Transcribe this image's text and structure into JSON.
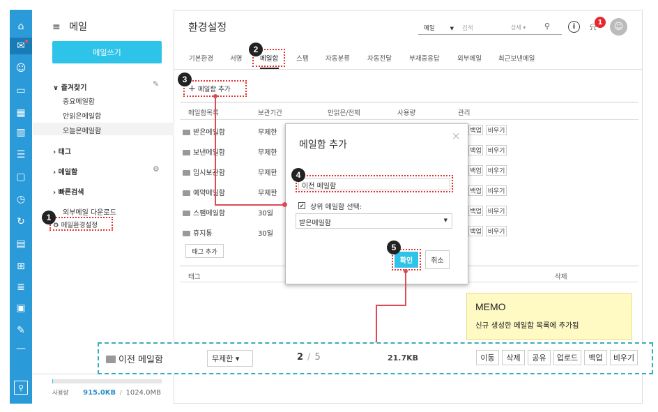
{
  "sidebar_title": "메일",
  "compose_label": "메일쓰기",
  "favorites": {
    "label": "즐겨찾기",
    "items": [
      "중요메일함",
      "안읽은메일함",
      "오늘온메일함"
    ]
  },
  "tags_label": "태그",
  "mailbox_label": "메일함",
  "quick_search_label": "빠른검색",
  "external_download": "외부메일 다운로드",
  "mail_settings": "메일환경설정",
  "usage": {
    "label": "사용량",
    "used": "915.0KB",
    "sep": "/",
    "total": "1024.0MB",
    "fraction": 0.001
  },
  "page_title": "환경설정",
  "search": {
    "scope": "메일",
    "placeholder": "검색",
    "detail": "상세 ▾"
  },
  "notification_count": "1",
  "tabs": [
    "기본환경",
    "서명",
    "메일함",
    "스팸",
    "자동분류",
    "자동전달",
    "부재중응답",
    "외부메일",
    "최근보낸메일"
  ],
  "add_mailbox": "메일함 추가",
  "table_headers": [
    "메일함목록",
    "보관기간",
    "안읽은/전체",
    "사용량",
    "관리"
  ],
  "rows": [
    {
      "name": "받은메일함",
      "period": "무제한"
    },
    {
      "name": "보낸메일함",
      "period": "무제한"
    },
    {
      "name": "임시보관함",
      "period": "무제한"
    },
    {
      "name": "예약메일함",
      "period": "무제한"
    },
    {
      "name": "스팸메일함",
      "period": "30일"
    },
    {
      "name": "휴지통",
      "period": "30일"
    }
  ],
  "row_btns": [
    "백업",
    "비우기"
  ],
  "add_tag": "태그 추가",
  "tag_header": "태그",
  "delete_header": "삭제",
  "dialog": {
    "title": "메일함 추가",
    "close": "×",
    "input_value": "이전 메일함",
    "checkbox_label": "상위 메일함 선택:",
    "select_value": "받은메일함",
    "confirm": "확인",
    "cancel": "취소"
  },
  "memo": {
    "title": "MEMO",
    "text": "신규 생성한 메일함 목록에 추가됨"
  },
  "new_row": {
    "name": "이전 메일함",
    "period": "무제한 ▾",
    "unread": "2",
    "sep": "/",
    "total": "5",
    "size": "21.7KB",
    "buttons": [
      "이동",
      "삭제",
      "공유",
      "업로드",
      "백업",
      "비우기"
    ]
  },
  "badges": [
    "1",
    "2",
    "3",
    "4",
    "5"
  ],
  "icons": [
    "home-icon",
    "mail-icon",
    "person-icon",
    "folder-icon",
    "calendar-icon",
    "board-icon",
    "list-icon",
    "chat-icon",
    "clock-icon",
    "refresh-icon",
    "note-icon",
    "grid-icon",
    "stack-icon",
    "doc-icon",
    "edit-icon",
    "minus-icon",
    "org-icon"
  ]
}
